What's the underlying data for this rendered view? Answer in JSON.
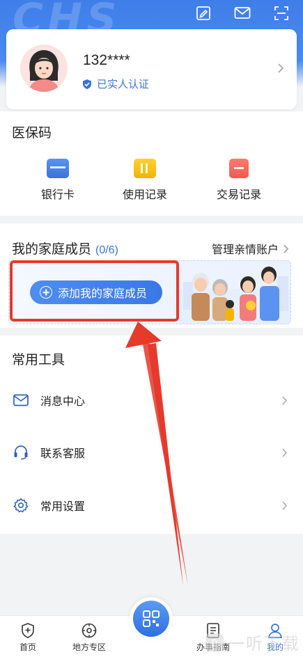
{
  "header": {
    "watermark": "CHS"
  },
  "profile": {
    "name": "132****",
    "verified_text": "已实人认证"
  },
  "medical_code": {
    "title": "医保码",
    "items": [
      {
        "label": "银行卡",
        "icon": "bank-card-icon",
        "color": "#3a73d6"
      },
      {
        "label": "使用记录",
        "icon": "usage-record-icon",
        "color": "#f5b400"
      },
      {
        "label": "交易记录",
        "icon": "transaction-record-icon",
        "color": "#f05a4f"
      }
    ]
  },
  "family": {
    "title": "我的家庭成员",
    "count": "(0/6)",
    "manage_label": "管理亲情账户",
    "add_button": "添加我的家庭成员"
  },
  "tools": {
    "title": "常用工具",
    "items": [
      {
        "label": "消息中心",
        "icon": "mail-icon"
      },
      {
        "label": "联系客服",
        "icon": "headset-icon"
      },
      {
        "label": "常用设置",
        "icon": "gear-icon"
      }
    ]
  },
  "tabbar": {
    "items": [
      {
        "label": "首页",
        "icon": "home-shield-icon"
      },
      {
        "label": "地方专区",
        "icon": "location-icon"
      },
      {
        "label": "办事指南",
        "icon": "guide-icon"
      },
      {
        "label": "我的",
        "icon": "profile-icon"
      }
    ]
  },
  "brand_watermark": {
    "logo": "0",
    "text": "一听下载"
  },
  "colors": {
    "accent": "#3a73d6",
    "highlight": "#e53a2c"
  }
}
